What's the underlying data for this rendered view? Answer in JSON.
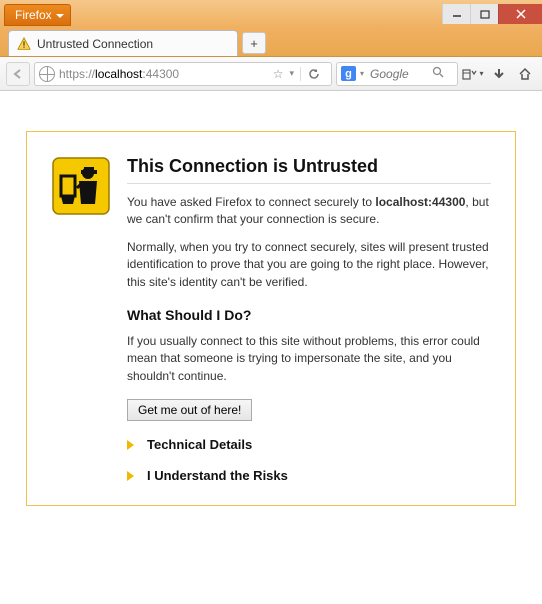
{
  "titlebar": {
    "app_menu_label": "Firefox"
  },
  "tab": {
    "title": "Untrusted Connection"
  },
  "navbar": {
    "url_scheme": "https://",
    "url_host": "localhost",
    "url_port": ":44300",
    "search_placeholder": "Google"
  },
  "page": {
    "heading": "This Connection is Untrusted",
    "para1_pre": "You have asked Firefox to connect securely to ",
    "para1_host": "localhost:44300",
    "para1_post": ", but we can't confirm that your connection is secure.",
    "para2": "Normally, when you try to connect securely, sites will present trusted identification to prove that you are going to the right place. However, this site's identity can't be verified.",
    "subheading": "What Should I Do?",
    "para3": "If you usually connect to this site without problems, this error could mean that someone is trying to impersonate the site, and you shouldn't continue.",
    "button_label": "Get me out of here!",
    "expander1": "Technical Details",
    "expander2": "I Understand the Risks"
  }
}
